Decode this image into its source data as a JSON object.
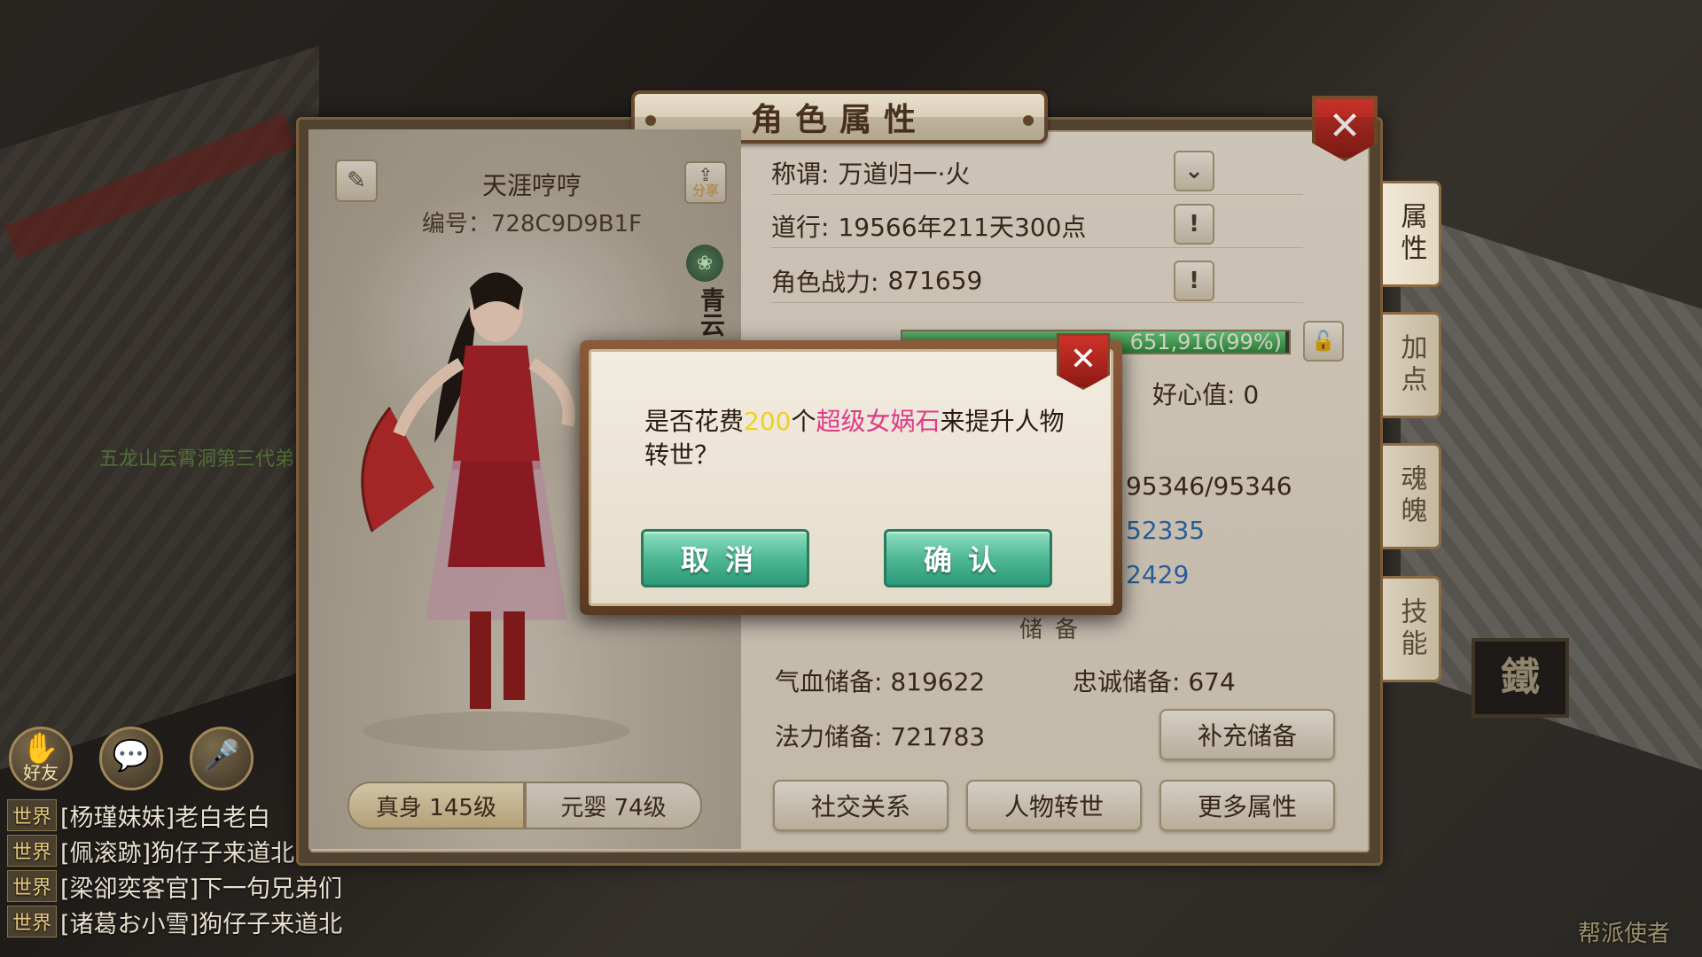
{
  "window": {
    "title": "角色属性"
  },
  "character": {
    "name": "天涯哼哼",
    "id_label": "编号：728C9D9B1F",
    "share_label": "分享",
    "sect_text": "青云",
    "levels": [
      {
        "label": "真身 145级",
        "active": true
      },
      {
        "label": "元婴 74级",
        "active": false
      }
    ]
  },
  "info": {
    "title_label": "称谓:",
    "title_value": "万道归一·火",
    "daoxing_label": "道行:",
    "daoxing_value": "19566年211天300点",
    "power_label": "角色战力:",
    "power_value": "871659",
    "exp_text": "651,916(99%)",
    "exp_percent": 99,
    "goodwill_label": "好心值:",
    "goodwill_value": "0",
    "hp_value": "95346/95346",
    "stat_a": "52335",
    "stat_b": "2429",
    "reserve_title": "储备",
    "hp_reserve_label": "气血储备:",
    "hp_reserve_value": "819622",
    "loyalty_reserve_label": "忠诚储备:",
    "loyalty_reserve_value": "674",
    "mp_reserve_label": "法力储备:",
    "mp_reserve_value": "721783"
  },
  "buttons": {
    "refill_reserve": "补充储备",
    "social": "社交关系",
    "rebirth": "人物转世",
    "more_attrs": "更多属性"
  },
  "side_tabs": [
    "属性",
    "加点",
    "魂魄",
    "技能"
  ],
  "modal": {
    "text_prefix": "是否花费",
    "amount": "200",
    "text_mid": "个",
    "item": "超级女娲石",
    "text_suffix": "来提升人物转世？",
    "cancel": "取消",
    "confirm": "确认"
  },
  "hud": {
    "friend_label": "好友",
    "guild_text": "五龙山云霄洞第三代弟",
    "chat": [
      {
        "tag": "世界",
        "text": "[杨瑾妹妹]老白老白"
      },
      {
        "tag": "世界",
        "text": "[佩滚跡]狗仔子来道北"
      },
      {
        "tag": "世界",
        "text": "[梁卻奕客官]下一句兄弟们"
      },
      {
        "tag": "世界",
        "text": "[诸葛お小雪]狗仔子来道北"
      }
    ],
    "npc_label": "帮派使者",
    "shop_sign": "鐵"
  },
  "colors": {
    "accent_yellow": "#f0d020",
    "accent_pink": "#e03a8a",
    "stat_blue": "#2a6ab0",
    "close_red": "#c8322a",
    "confirm_green": "#4fb894"
  }
}
